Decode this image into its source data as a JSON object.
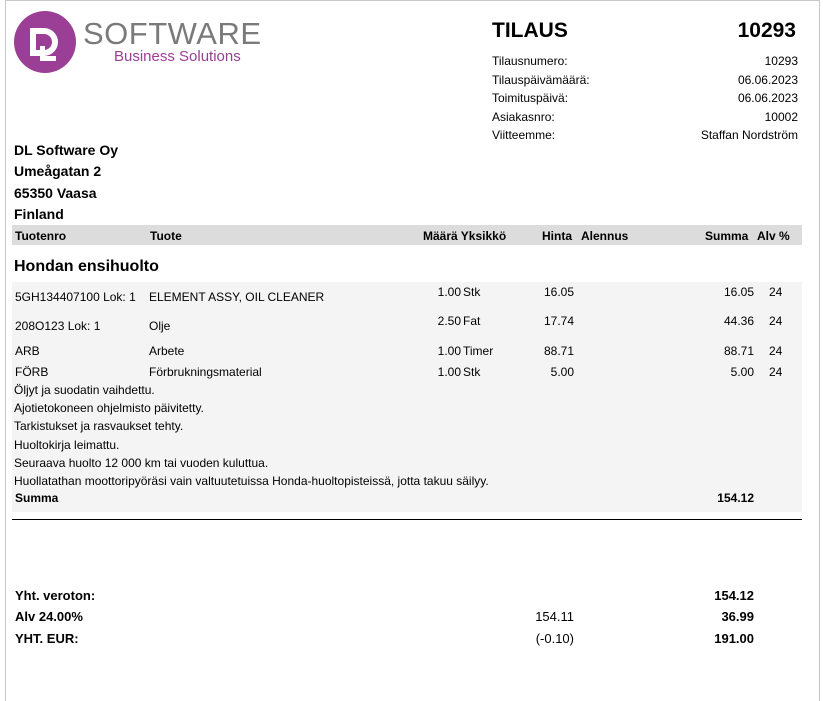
{
  "logo": {
    "word": "SOFTWARE",
    "subtitle": "Business Solutions",
    "brand_color": "#9b3e96"
  },
  "header": {
    "title": "TILAUS",
    "number": "10293",
    "meta": [
      {
        "label": "Tilausnumero:",
        "value": "10293"
      },
      {
        "label": "Tilauspäivämäärä:",
        "value": "06.06.2023"
      },
      {
        "label": "Toimituspäivä:",
        "value": "06.06.2023"
      },
      {
        "label": "Asiakasnro:",
        "value": "10002"
      },
      {
        "label": "Viitteemme:",
        "value": "Staffan Nordström"
      }
    ]
  },
  "address": {
    "line1": "DL Software Oy",
    "line2": "Umeågatan 2",
    "line3": "65350 Vaasa",
    "line4": "Finland"
  },
  "table": {
    "headers": {
      "code": "Tuotenro",
      "product": "Tuote",
      "qty_unit": "Määrä Yksikkö",
      "price": "Hinta",
      "discount": "Alennus",
      "sum": "Summa",
      "vat": "Alv %"
    },
    "section_title": "Hondan ensihuolto",
    "rows": [
      {
        "code": "5GH134407100 Lok: 1",
        "product": "ELEMENT ASSY, OIL CLEANER",
        "qty": "1.00",
        "unit": "Stk",
        "price": "16.05",
        "sum": "16.05",
        "vat": "24"
      },
      {
        "code": "208O123 Lok: 1",
        "product": "Olje",
        "qty": "2.50",
        "unit": "Fat",
        "price": "17.74",
        "sum": "44.36",
        "vat": "24"
      },
      {
        "code": "ARB",
        "product": "Arbete",
        "qty": "1.00",
        "unit": "Timer",
        "price": "88.71",
        "sum": "88.71",
        "vat": "24"
      },
      {
        "code": "FÖRB",
        "product": "Förbrukningsmaterial",
        "qty": "1.00",
        "unit": "Stk",
        "price": "5.00",
        "sum": "5.00",
        "vat": "24"
      }
    ],
    "notes": [
      "Öljyt ja suodatin vaihdettu.",
      "Ajotietokoneen ohjelmisto päivitetty.",
      "Tarkistukset ja rasvaukset tehty.",
      "Huoltokirja leimattu.",
      "Seuraava huolto 12 000 km tai vuoden kuluttua.",
      "Huollatathan moottoripyöräsi vain valtuutetuissa Honda-huoltopisteissä, jotta takuu säilyy."
    ],
    "sum_label": "Summa",
    "sum_value": "154.12"
  },
  "totals": {
    "net_label": "Yht. veroton:",
    "net_value": "154.12",
    "vat_label": "Alv 24.00%",
    "vat_base": "154.11",
    "vat_value": "36.99",
    "total_label": "YHT. EUR:",
    "rounding": "(-0.10)",
    "total_value": "191.00"
  }
}
